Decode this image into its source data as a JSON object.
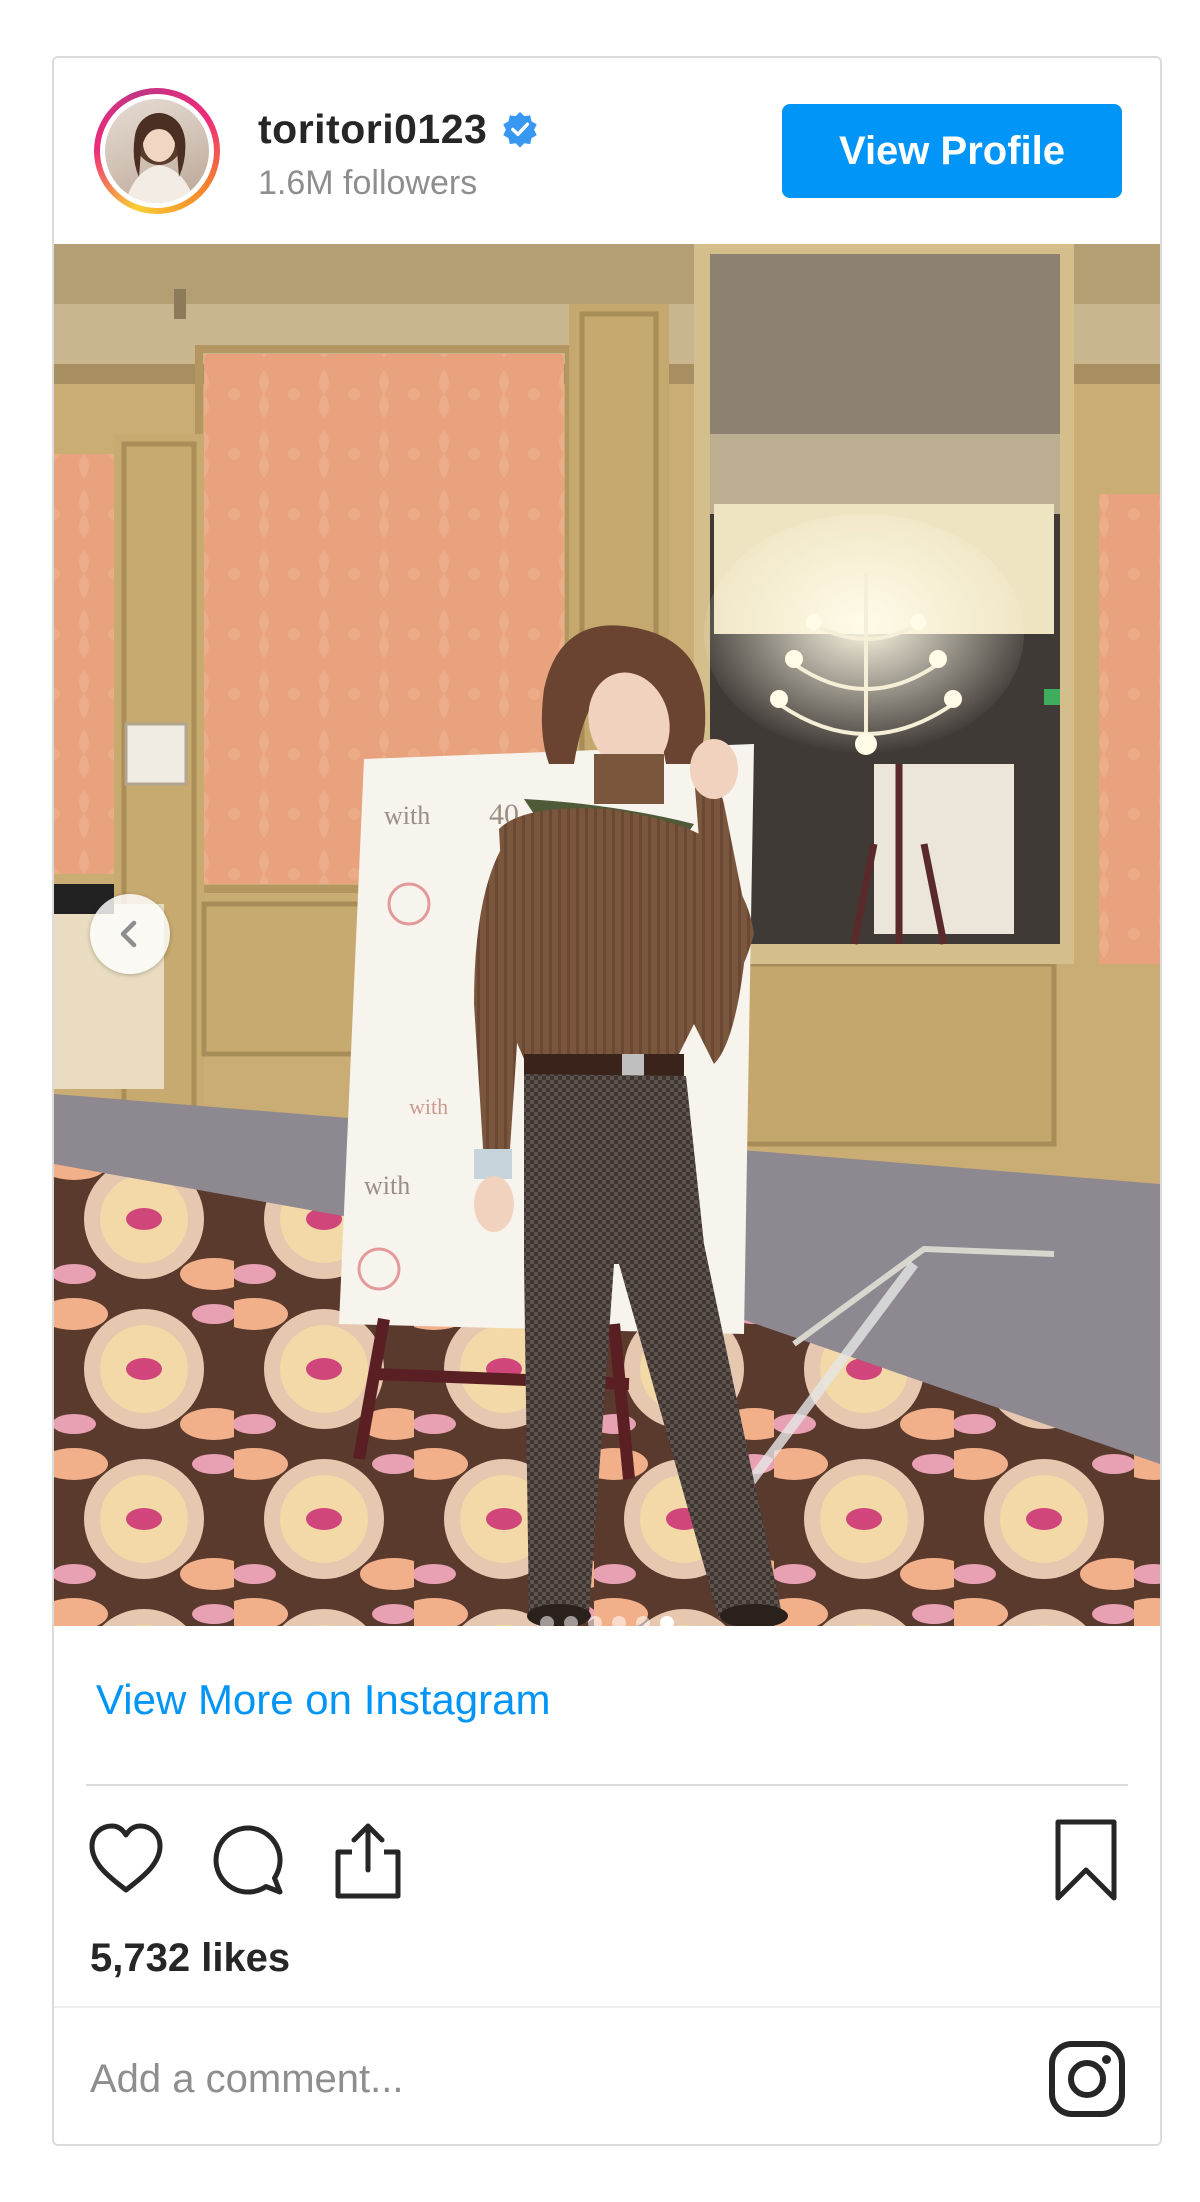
{
  "post": {
    "username": "toritori0123",
    "followers": "1.6M followers",
    "view_profile_label": "View Profile",
    "photo_sign_texts": [
      "with",
      "40",
      "with",
      "with"
    ],
    "carousel": {
      "dot_count": 6,
      "active_index": 5
    },
    "view_more_label": "View More on Instagram",
    "likes": "5,732 likes",
    "comment_placeholder": "Add a comment..."
  },
  "colors": {
    "accent": "#0095f6",
    "text": "#262626",
    "muted": "#8e8e8e",
    "border": "#dbdbdb"
  },
  "icons": [
    "verified-badge-icon",
    "chevron-left-icon",
    "heart-icon",
    "comment-icon",
    "share-icon",
    "bookmark-icon",
    "instagram-logo-icon"
  ]
}
